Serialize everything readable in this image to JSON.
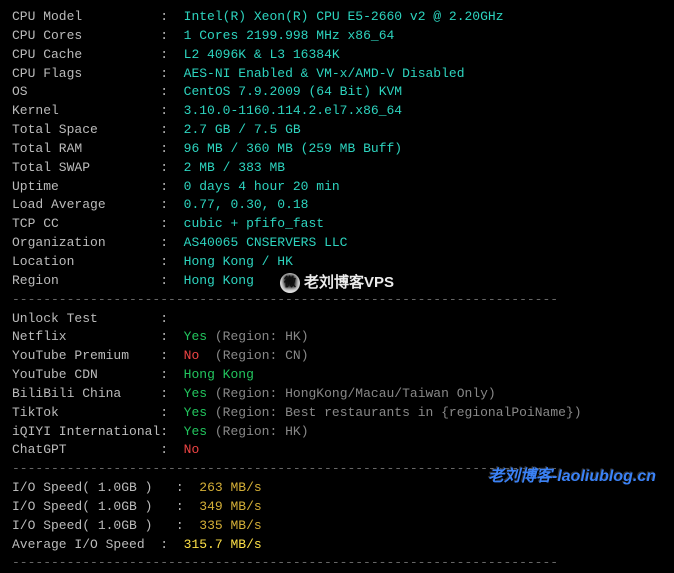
{
  "sys": {
    "cpu_model": {
      "label": "CPU Model",
      "value": "Intel(R) Xeon(R) CPU E5-2660 v2 @ 2.20GHz"
    },
    "cpu_cores": {
      "label": "CPU Cores",
      "value": "1 Cores 2199.998 MHz x86_64"
    },
    "cpu_cache": {
      "label": "CPU Cache",
      "value": "L2 4096K & L3 16384K"
    },
    "cpu_flags": {
      "label": "CPU Flags",
      "value": "AES-NI Enabled & VM-x/AMD-V Disabled"
    },
    "os": {
      "label": "OS",
      "value": "CentOS 7.9.2009 (64 Bit) KVM"
    },
    "kernel": {
      "label": "Kernel",
      "value": "3.10.0-1160.114.2.el7.x86_64"
    },
    "total_space": {
      "label": "Total Space",
      "value": "2.7 GB / 7.5 GB"
    },
    "total_ram": {
      "label": "Total RAM",
      "value": "96 MB / 360 MB (259 MB Buff)"
    },
    "total_swap": {
      "label": "Total SWAP",
      "value": "2 MB / 383 MB"
    },
    "uptime": {
      "label": "Uptime",
      "value": "0 days 4 hour 20 min"
    },
    "load_avg": {
      "label": "Load Average",
      "value": "0.77, 0.30, 0.18"
    },
    "tcp_cc": {
      "label": "TCP CC",
      "value": "cubic + pfifo_fast"
    },
    "org": {
      "label": "Organization",
      "value": "AS40065 CNSERVERS LLC"
    },
    "location": {
      "label": "Location",
      "value": "Hong Kong / HK"
    },
    "region": {
      "label": "Region",
      "value": "Hong Kong"
    }
  },
  "unlock_heading": "Unlock Test",
  "unlock": {
    "netflix": {
      "label": "Netflix",
      "status": "Yes",
      "note": "(Region: HK)"
    },
    "yt_premium": {
      "label": "YouTube Premium",
      "status": "No",
      "note": "(Region: CN)"
    },
    "yt_cdn": {
      "label": "YouTube CDN",
      "status": "Hong Kong",
      "note": ""
    },
    "bilibili": {
      "label": "BiliBili China",
      "status": "Yes",
      "note": "(Region: HongKong/Macau/Taiwan Only)"
    },
    "tiktok": {
      "label": "TikTok",
      "status": "Yes",
      "note": "(Region: Best restaurants in {regionalPoiName})"
    },
    "iqiyi": {
      "label": "iQIYI International",
      "status": "Yes",
      "note": "(Region: HK)"
    },
    "chatgpt": {
      "label": "ChatGPT",
      "status": "No",
      "note": ""
    }
  },
  "io": {
    "r1": {
      "label": "I/O Speed( 1.0GB )",
      "value": "263 MB/s"
    },
    "r2": {
      "label": "I/O Speed( 1.0GB )",
      "value": "349 MB/s"
    },
    "r3": {
      "label": "I/O Speed( 1.0GB )",
      "value": "335 MB/s"
    },
    "avg": {
      "label": "Average I/O Speed",
      "value": "315.7 MB/s"
    }
  },
  "divider": "----------------------------------------------------------------------",
  "watermarks": {
    "center": "老刘博客VPS",
    "center_icon": "微",
    "bottom_right": "老刘博客-laoliublog.cn"
  }
}
